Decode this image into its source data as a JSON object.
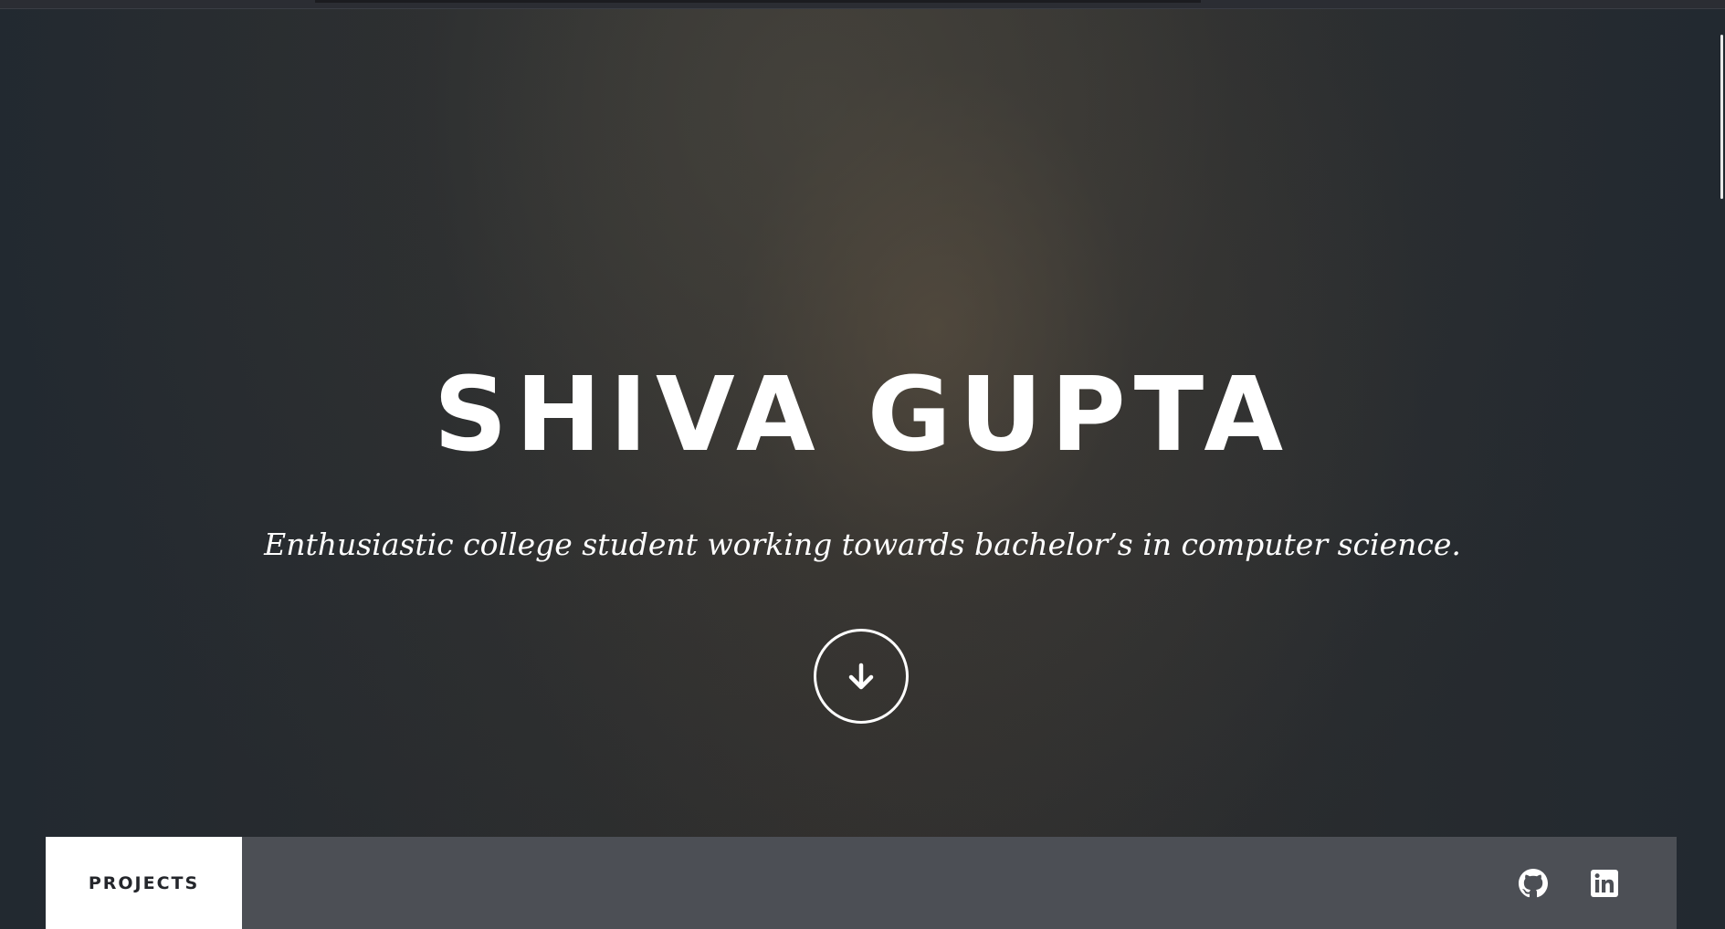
{
  "hero": {
    "title": "SHIVA GUPTA",
    "tagline": "Enthusiastic college student working towards bachelor’s in computer science.",
    "scroll_icon": "arrow-down-circle-icon"
  },
  "nav": {
    "items": [
      {
        "label": "PROJECTS",
        "active": true
      }
    ],
    "social": [
      {
        "icon": "github-icon"
      },
      {
        "icon": "linkedin-icon"
      }
    ]
  },
  "colors": {
    "text": "#ffffff",
    "nav_bar": "#4c4f55",
    "nav_active_bg": "#ffffff",
    "nav_active_text": "#24262b"
  }
}
